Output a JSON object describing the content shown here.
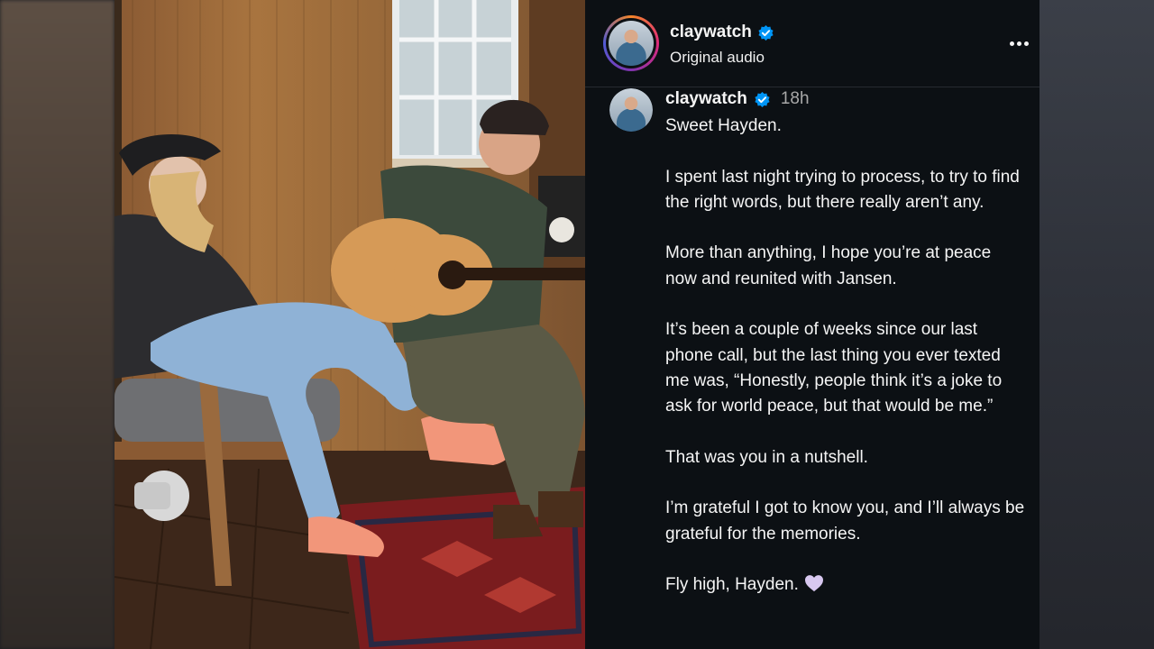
{
  "post": {
    "username": "claywatch",
    "audio_label": "Original audio",
    "verified_icon": "verified-badge-icon",
    "more_icon": "more-options-icon"
  },
  "caption": {
    "username": "claywatch",
    "time": "18h",
    "paragraphs": [
      "Sweet Hayden.",
      "I spent last night trying to process, to try to find the right words, but there really aren’t any.",
      "More than anything, I hope you’re at peace now and reunited with Jansen.",
      "It’s been a couple of weeks since our last phone call, but the last thing you ever texted me was, “Honestly, people think it’s a joke to ask for world peace, but that would be me.”",
      "That was you in a nutshell.",
      "I’m grateful I got to know you, and I’ll always be grateful for the memories.",
      "Fly high, Hayden."
    ],
    "closing_emoji": "heart-icon"
  },
  "colors": {
    "panel_bg": "#0c1014",
    "text": "#f5f5f5",
    "muted": "#a8a8a8",
    "verified": "#0095f6",
    "heart": "#d8c8f0"
  }
}
